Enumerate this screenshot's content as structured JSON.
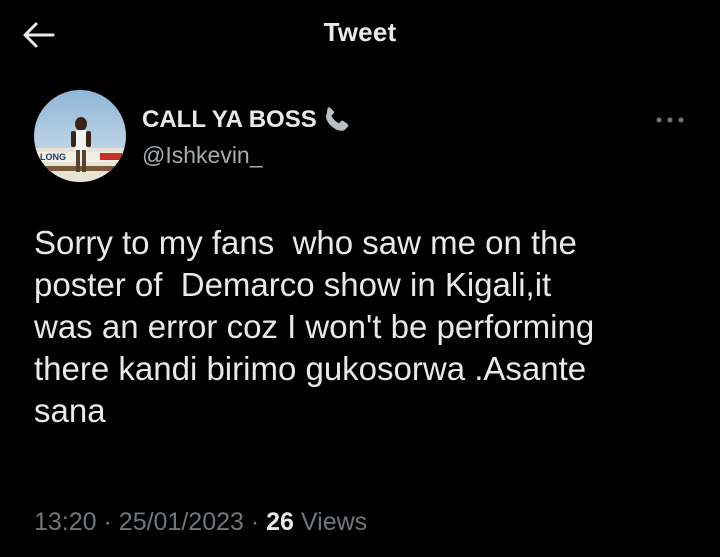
{
  "header": {
    "title": "Tweet",
    "back_icon": "arrow-left-icon"
  },
  "author": {
    "display_name": "CALL YA BOSS",
    "name_emoji": "telephone-receiver-icon",
    "handle": "@Ishkevin_",
    "avatar_icon": "profile-avatar-photo",
    "avatar_text": "LONG"
  },
  "more_icon": "more-dots-icon",
  "tweet": {
    "text": "Sorry to my fans  who saw me on the\nposter of  Demarco show in Kigali,it\nwas an error coz I won't be performing\nthere kandi birimo gukosorwa .Asante\nsana"
  },
  "meta": {
    "time": "13:20",
    "separator": "·",
    "date": "25/01/2023",
    "views_count": "26",
    "views_label": "Views"
  },
  "colors": {
    "background": "#000000",
    "primary_text": "#e7e9ea",
    "secondary_text": "#71767b",
    "handle_text": "#a7acb0"
  }
}
